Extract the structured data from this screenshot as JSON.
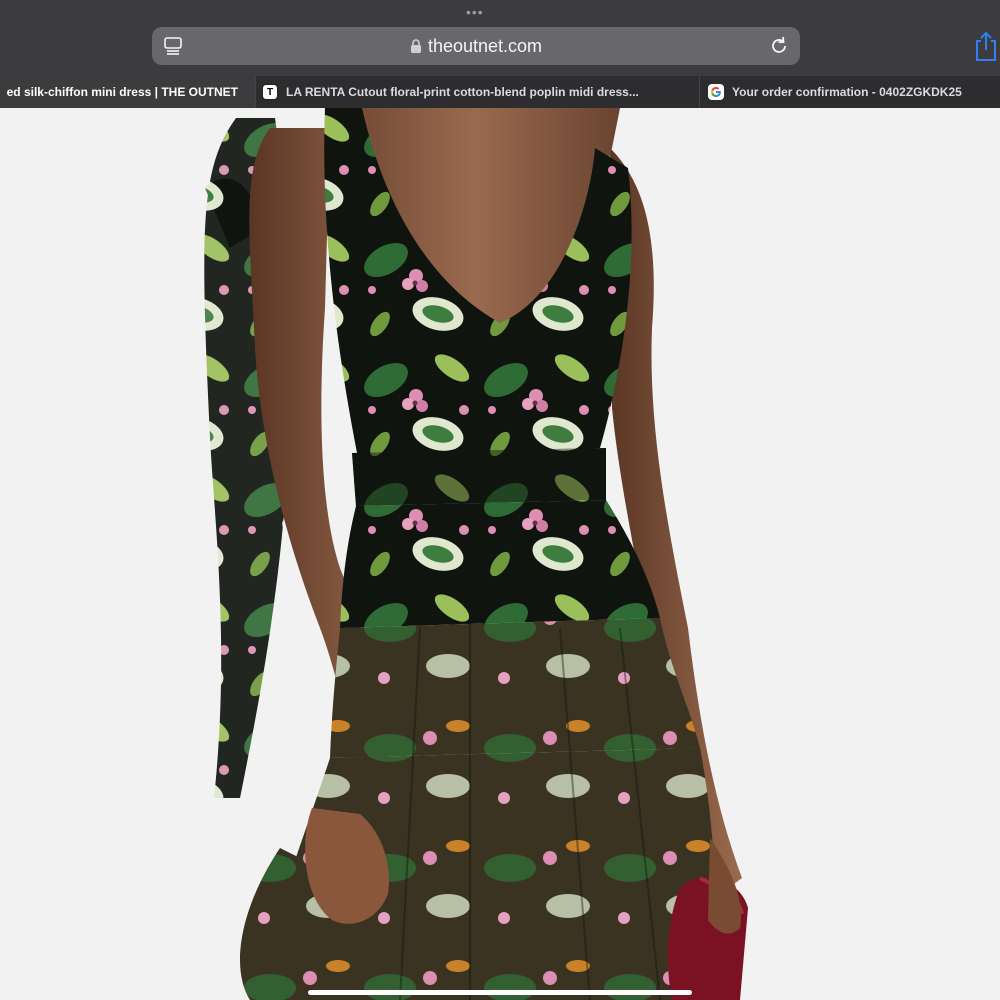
{
  "browser": {
    "url": "theoutnet.com",
    "more_dots": "•••"
  },
  "tabs": [
    {
      "title": "ed silk-chiffon mini dress | THE OUTNET",
      "favicon": "",
      "active": true
    },
    {
      "title": "LA RENTA Cutout floral-print cotton-blend poplin midi dress...",
      "favicon": "T",
      "active": false
    },
    {
      "title": "Your order confirmation - 0402ZGKDK25",
      "favicon": "G",
      "active": false
    }
  ],
  "colors": {
    "toolbar_bg": "#3c3c3e",
    "tabbar_bg": "#2d2d2f",
    "address_bg": "#68686c",
    "share_blue": "#2f7ff5",
    "page_bg": "#f2f2f2"
  },
  "icons": [
    "reader-icon",
    "lock-icon",
    "reload-icon",
    "share-icon",
    "google-favicon-icon"
  ],
  "product_image": {
    "subject": "floral-print mini dress on model",
    "palette": [
      "#0f140f",
      "#2f6b34",
      "#9bbf5a",
      "#dd8fb3",
      "#7a4b33",
      "#7b1224"
    ]
  }
}
